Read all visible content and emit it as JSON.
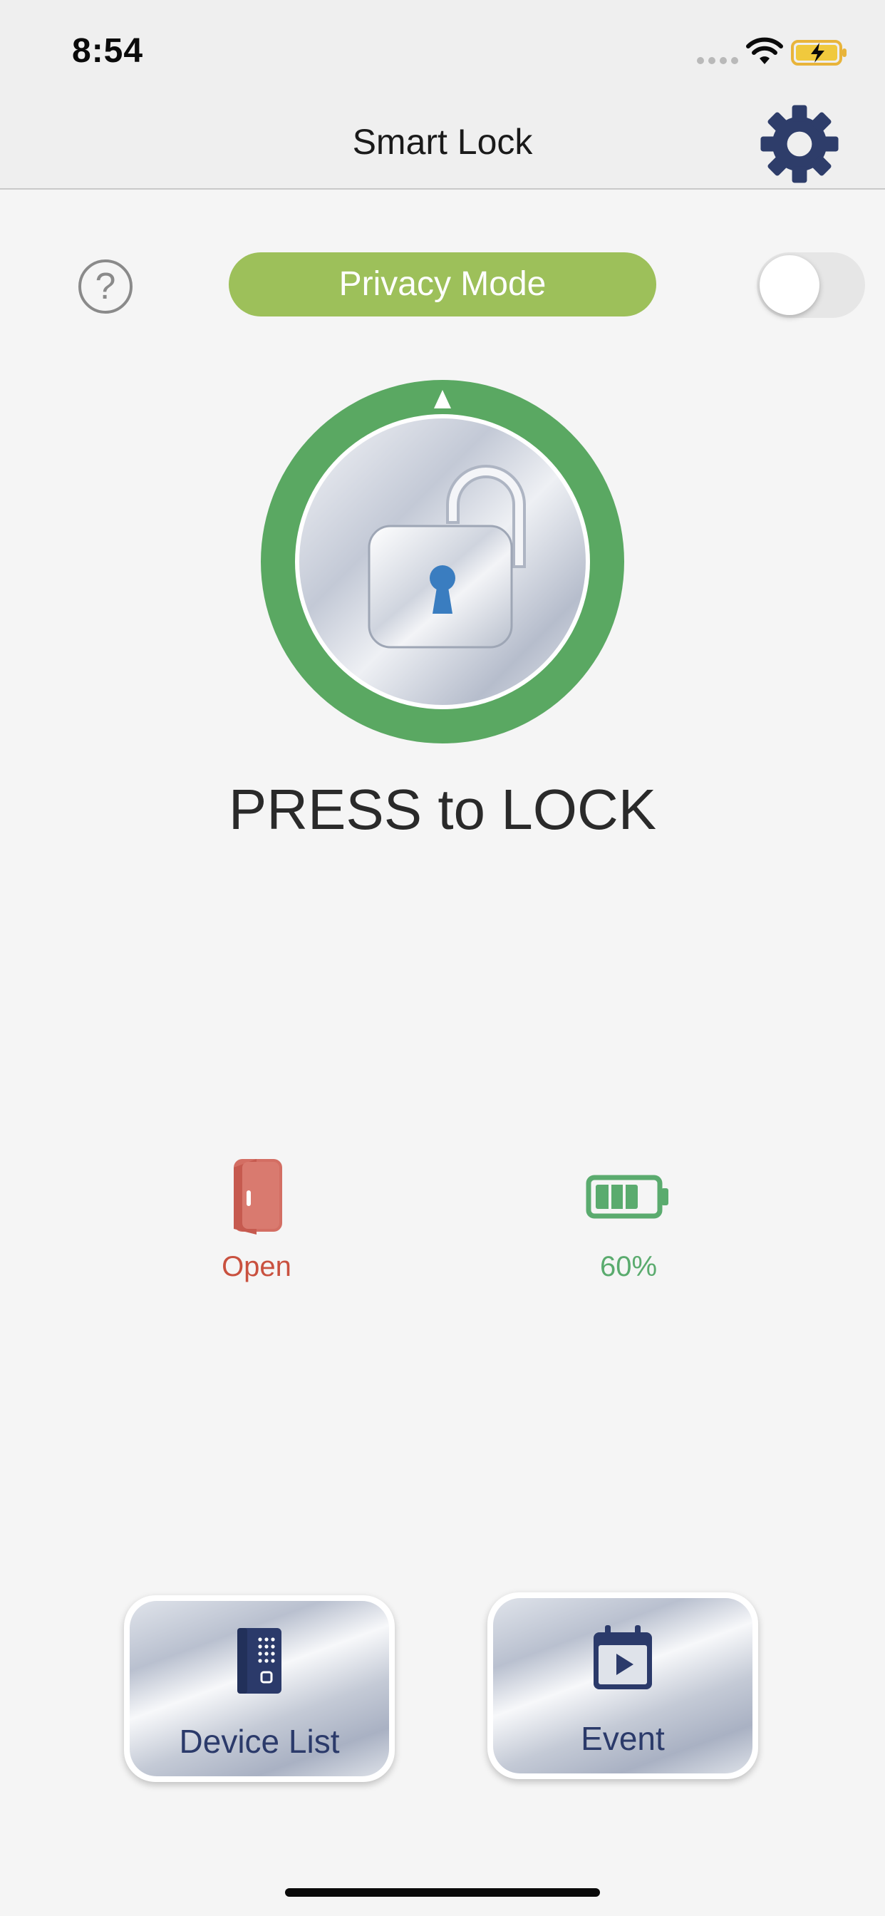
{
  "status_bar": {
    "time": "8:54"
  },
  "nav": {
    "title": "Smart Lock"
  },
  "privacy": {
    "help_glyph": "?",
    "mode_label": "Privacy Mode",
    "toggle_on": false
  },
  "lock": {
    "action_label": "PRESS to LOCK",
    "state": "unlocked"
  },
  "status": {
    "door_label": "Open",
    "battery_label": "60%",
    "battery_level_percent": 60
  },
  "buttons": {
    "device_list_label": "Device List",
    "event_label": "Event"
  },
  "colors": {
    "accent_blue": "#2b3a6a",
    "privacy_green": "#9dc05a",
    "lock_ring_green": "#5aa862",
    "door_open_red": "#c9513f",
    "battery_green": "#5aab6e"
  },
  "icons": {
    "settings": "gear-icon",
    "help": "question-circle-icon",
    "lock": "padlock-open-icon",
    "door": "door-open-icon",
    "battery": "battery-icon",
    "device_list": "device-keypad-icon",
    "event": "calendar-play-icon",
    "wifi": "wifi-icon",
    "charging": "battery-charging-icon"
  }
}
